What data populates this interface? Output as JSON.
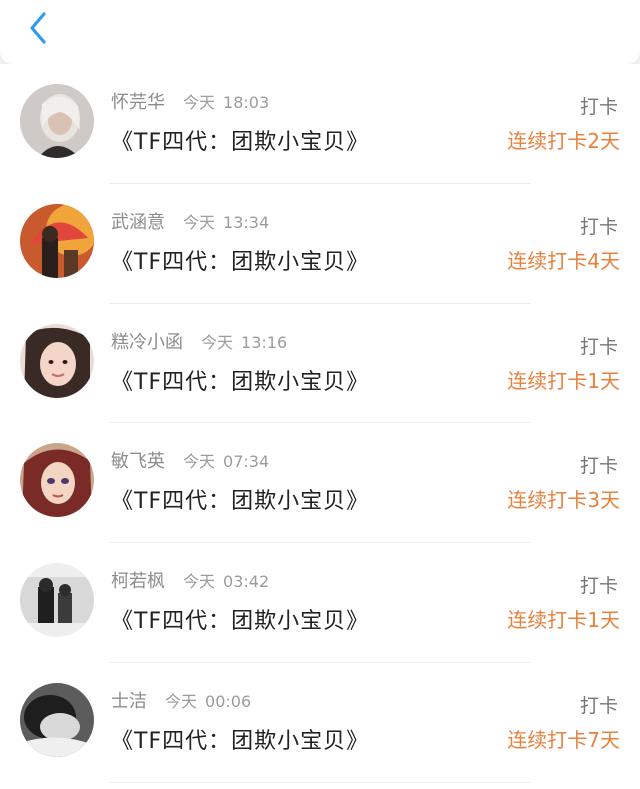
{
  "header": {
    "back_icon": "chevron-left-icon",
    "accent_color": "#2f9cf4"
  },
  "entries": [
    {
      "name": "怀芫华",
      "date": "今天",
      "time": "18:03",
      "title": "《TF四代：团欺小宝贝》",
      "action": "打卡",
      "streak": "连续打卡2天"
    },
    {
      "name": "武涵意",
      "date": "今天",
      "time": "13:34",
      "title": "《TF四代：团欺小宝贝》",
      "action": "打卡",
      "streak": "连续打卡4天"
    },
    {
      "name": "糕冷小函",
      "date": "今天",
      "time": "13:16",
      "title": "《TF四代：团欺小宝贝》",
      "action": "打卡",
      "streak": "连续打卡1天"
    },
    {
      "name": "敏飞英",
      "date": "今天",
      "time": "07:34",
      "title": "《TF四代：团欺小宝贝》",
      "action": "打卡",
      "streak": "连续打卡3天"
    },
    {
      "name": "柯若枫",
      "date": "今天",
      "time": "03:42",
      "title": "《TF四代：团欺小宝贝》",
      "action": "打卡",
      "streak": "连续打卡1天"
    },
    {
      "name": "士洁",
      "date": "今天",
      "time": "00:06",
      "title": "《TF四代：团欺小宝贝》",
      "action": "打卡",
      "streak": "连续打卡7天"
    }
  ],
  "colors": {
    "streak": "#e9813d",
    "name": "#8d8d8d",
    "title": "#222222"
  }
}
